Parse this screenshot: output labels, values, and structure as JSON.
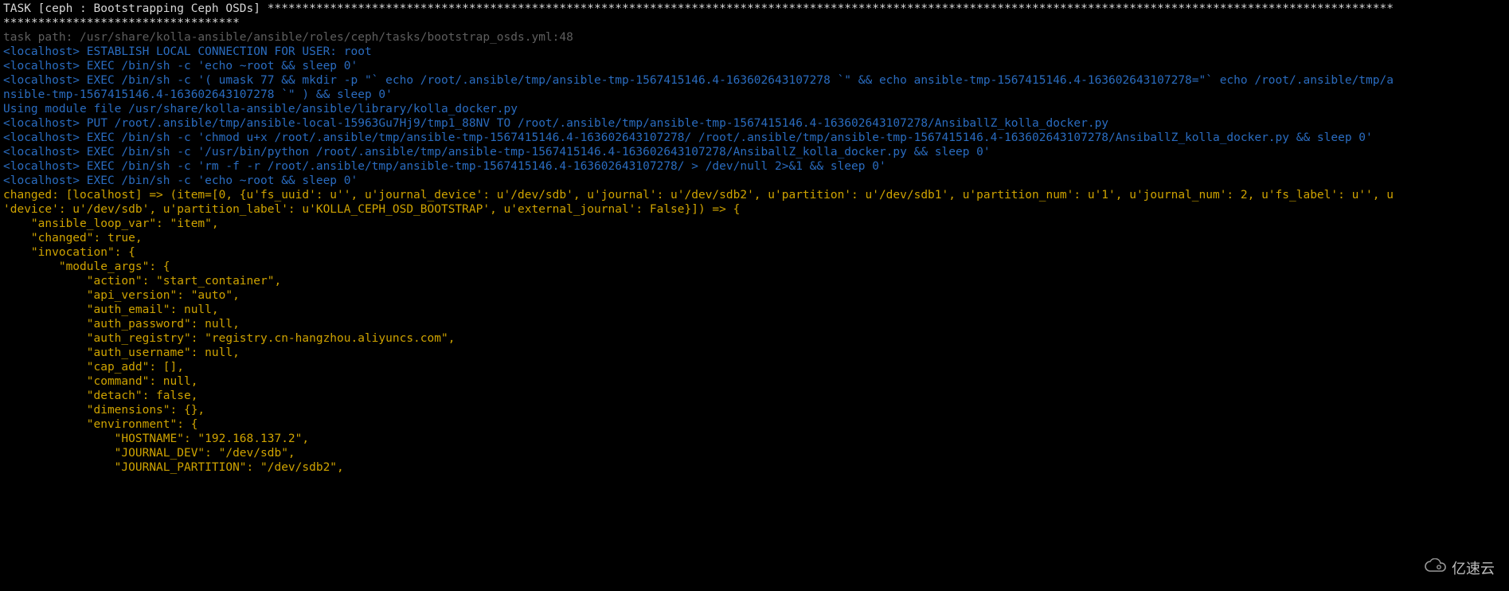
{
  "watermark": {
    "text": "亿速云"
  },
  "lines": [
    {
      "cls": "white",
      "text": "TASK [ceph : Bootstrapping Ceph OSDs] ****************************************************************************************************************************************************************************************************"
    },
    {
      "cls": "grey",
      "text": "task path: /usr/share/kolla-ansible/ansible/roles/ceph/tasks/bootstrap_osds.yml:48"
    },
    {
      "cls": "blue",
      "text": "<localhost> ESTABLISH LOCAL CONNECTION FOR USER: root"
    },
    {
      "cls": "blue",
      "text": "<localhost> EXEC /bin/sh -c 'echo ~root && sleep 0'"
    },
    {
      "cls": "blue",
      "text": "<localhost> EXEC /bin/sh -c '( umask 77 && mkdir -p \"` echo /root/.ansible/tmp/ansible-tmp-1567415146.4-163602643107278 `\" && echo ansible-tmp-1567415146.4-163602643107278=\"` echo /root/.ansible/tmp/ansible-tmp-1567415146.4-163602643107278 `\" ) && sleep 0'"
    },
    {
      "cls": "blue",
      "text": "Using module file /usr/share/kolla-ansible/ansible/library/kolla_docker.py"
    },
    {
      "cls": "blue",
      "text": "<localhost> PUT /root/.ansible/tmp/ansible-local-15963Gu7Hj9/tmp1_88NV TO /root/.ansible/tmp/ansible-tmp-1567415146.4-163602643107278/AnsiballZ_kolla_docker.py"
    },
    {
      "cls": "blue",
      "text": "<localhost> EXEC /bin/sh -c 'chmod u+x /root/.ansible/tmp/ansible-tmp-1567415146.4-163602643107278/ /root/.ansible/tmp/ansible-tmp-1567415146.4-163602643107278/AnsiballZ_kolla_docker.py && sleep 0'"
    },
    {
      "cls": "blue",
      "text": "<localhost> EXEC /bin/sh -c '/usr/bin/python /root/.ansible/tmp/ansible-tmp-1567415146.4-163602643107278/AnsiballZ_kolla_docker.py && sleep 0'"
    },
    {
      "cls": "blue",
      "text": "<localhost> EXEC /bin/sh -c 'rm -f -r /root/.ansible/tmp/ansible-tmp-1567415146.4-163602643107278/ > /dev/null 2>&1 && sleep 0'"
    },
    {
      "cls": "blue",
      "text": "<localhost> EXEC /bin/sh -c 'echo ~root && sleep 0'"
    },
    {
      "cls": "yellow",
      "text": "changed: [localhost] => (item=[0, {u'fs_uuid': u'', u'journal_device': u'/dev/sdb', u'journal': u'/dev/sdb2', u'partition': u'/dev/sdb1', u'partition_num': u'1', u'journal_num': 2, u'fs_label': u'', u'device': u'/dev/sdb', u'partition_label': u'KOLLA_CEPH_OSD_BOOTSTRAP', u'external_journal': False}]) => {"
    },
    {
      "cls": "yellow",
      "text": "    \"ansible_loop_var\": \"item\","
    },
    {
      "cls": "yellow",
      "text": "    \"changed\": true,"
    },
    {
      "cls": "yellow",
      "text": "    \"invocation\": {"
    },
    {
      "cls": "yellow",
      "text": "        \"module_args\": {"
    },
    {
      "cls": "yellow",
      "text": "            \"action\": \"start_container\","
    },
    {
      "cls": "yellow",
      "text": "            \"api_version\": \"auto\","
    },
    {
      "cls": "yellow",
      "text": "            \"auth_email\": null,"
    },
    {
      "cls": "yellow",
      "text": "            \"auth_password\": null,"
    },
    {
      "cls": "yellow",
      "text": "            \"auth_registry\": \"registry.cn-hangzhou.aliyuncs.com\","
    },
    {
      "cls": "yellow",
      "text": "            \"auth_username\": null,"
    },
    {
      "cls": "yellow",
      "text": "            \"cap_add\": [],"
    },
    {
      "cls": "yellow",
      "text": "            \"command\": null,"
    },
    {
      "cls": "yellow",
      "text": "            \"detach\": false,"
    },
    {
      "cls": "yellow",
      "text": "            \"dimensions\": {},"
    },
    {
      "cls": "yellow",
      "text": "            \"environment\": {"
    },
    {
      "cls": "yellow",
      "text": "                \"HOSTNAME\": \"192.168.137.2\","
    },
    {
      "cls": "yellow",
      "text": "                \"JOURNAL_DEV\": \"/dev/sdb\","
    },
    {
      "cls": "yellow",
      "text": "                \"JOURNAL_PARTITION\": \"/dev/sdb2\","
    }
  ]
}
